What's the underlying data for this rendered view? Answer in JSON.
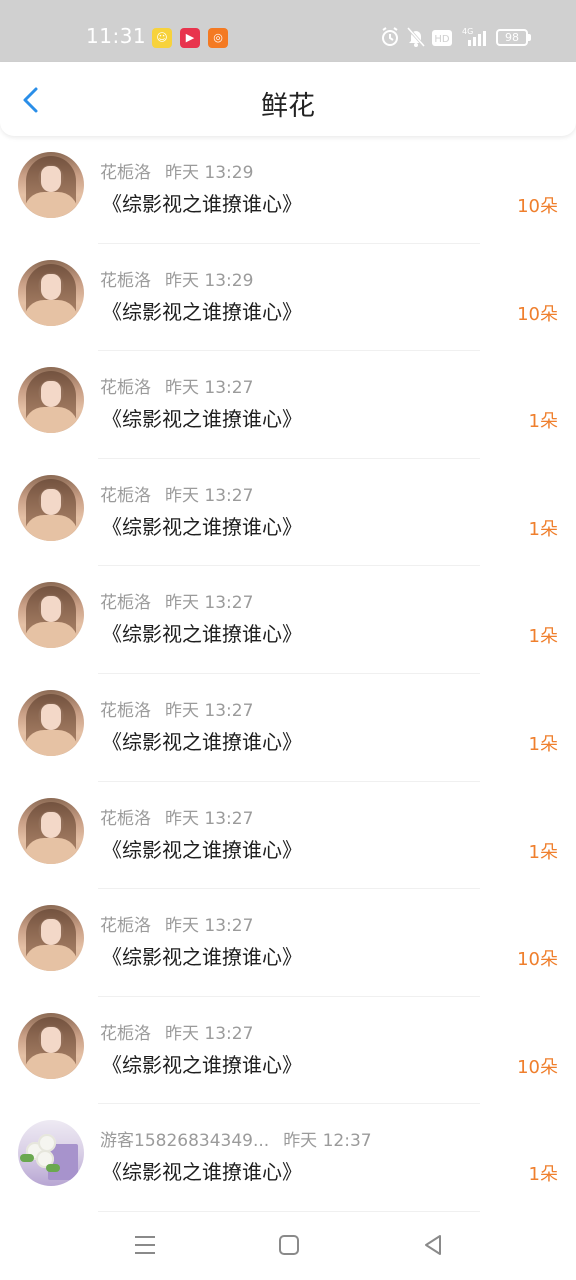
{
  "status_bar": {
    "time": "11:31",
    "battery": "98",
    "network": "4G",
    "hd": "HD",
    "icons": [
      "alarm-icon",
      "mute-icon",
      "hd-icon",
      "signal-icon",
      "battery-icon"
    ]
  },
  "header": {
    "title": "鲜花",
    "back_icon": "chevron-left-icon"
  },
  "colors": {
    "accent_blue": "#2a8ee8",
    "amount_orange": "#ef7f2d",
    "meta_gray": "#9b9b9b",
    "status_bar_bg": "#d0d0d0"
  },
  "rows": [
    {
      "user": "花栀洛",
      "time": "昨天 13:29",
      "book": "《综影视之谁撩谁心》",
      "amount": "10朵",
      "avatar": "girl"
    },
    {
      "user": "花栀洛",
      "time": "昨天 13:29",
      "book": "《综影视之谁撩谁心》",
      "amount": "10朵",
      "avatar": "girl"
    },
    {
      "user": "花栀洛",
      "time": "昨天 13:27",
      "book": "《综影视之谁撩谁心》",
      "amount": "1朵",
      "avatar": "girl"
    },
    {
      "user": "花栀洛",
      "time": "昨天 13:27",
      "book": "《综影视之谁撩谁心》",
      "amount": "1朵",
      "avatar": "girl"
    },
    {
      "user": "花栀洛",
      "time": "昨天 13:27",
      "book": "《综影视之谁撩谁心》",
      "amount": "1朵",
      "avatar": "girl"
    },
    {
      "user": "花栀洛",
      "time": "昨天 13:27",
      "book": "《综影视之谁撩谁心》",
      "amount": "1朵",
      "avatar": "girl"
    },
    {
      "user": "花栀洛",
      "time": "昨天 13:27",
      "book": "《综影视之谁撩谁心》",
      "amount": "1朵",
      "avatar": "girl"
    },
    {
      "user": "花栀洛",
      "time": "昨天 13:27",
      "book": "《综影视之谁撩谁心》",
      "amount": "10朵",
      "avatar": "girl"
    },
    {
      "user": "花栀洛",
      "time": "昨天 13:27",
      "book": "《综影视之谁撩谁心》",
      "amount": "10朵",
      "avatar": "girl"
    },
    {
      "user": "游客15826834349...",
      "time": "昨天 12:37",
      "book": "《综影视之谁撩谁心》",
      "amount": "1朵",
      "avatar": "flower"
    }
  ],
  "nav": {
    "menu_icon": "menu-icon",
    "home_icon": "home-square-icon",
    "back_icon": "back-triangle-icon"
  }
}
